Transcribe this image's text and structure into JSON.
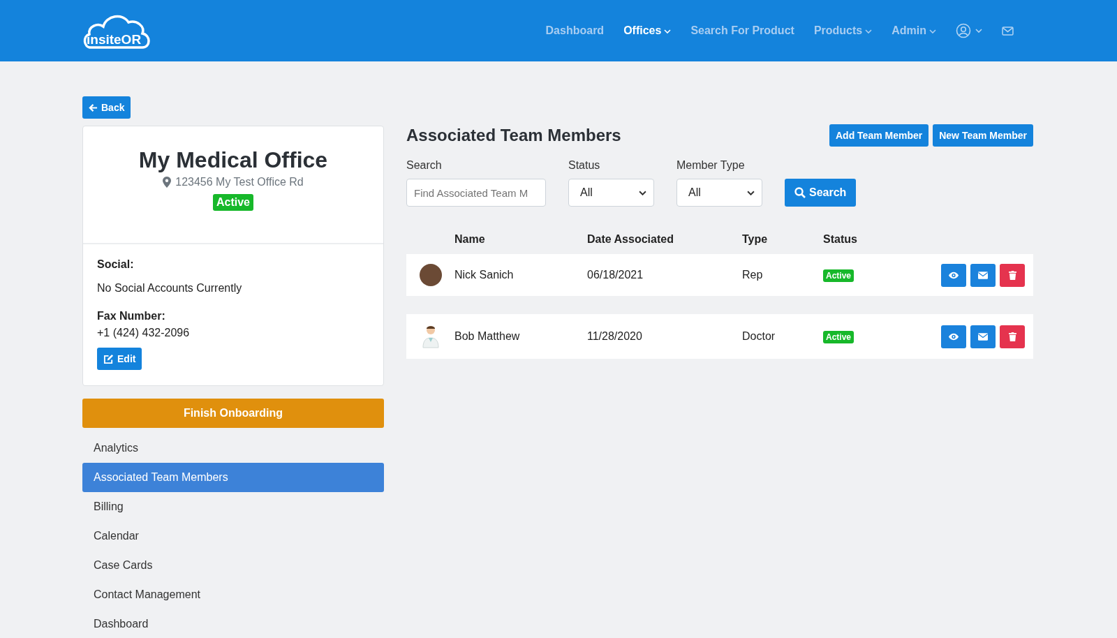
{
  "navbar": {
    "logo": "insiteOR",
    "items": [
      {
        "label": "Dashboard",
        "selected": false,
        "dropdown": false
      },
      {
        "label": "Offices",
        "selected": true,
        "dropdown": true
      },
      {
        "label": "Search For Product",
        "selected": false,
        "dropdown": false
      },
      {
        "label": "Products",
        "selected": false,
        "dropdown": true
      },
      {
        "label": "Admin",
        "selected": false,
        "dropdown": true
      }
    ]
  },
  "back_button": "Back",
  "office": {
    "name": "My Medical Office",
    "address": "123456 My Test Office Rd",
    "status": "Active",
    "social_label": "Social:",
    "social_value": "No Social Accounts Currently",
    "fax_label": "Fax Number:",
    "fax_value": "+1 (424) 432-2096",
    "edit_button": "Edit"
  },
  "finish_button": "Finish Onboarding",
  "sidebar": {
    "items": [
      {
        "label": "Analytics",
        "selected": false
      },
      {
        "label": "Associated Team Members",
        "selected": true
      },
      {
        "label": "Billing",
        "selected": false
      },
      {
        "label": "Calendar",
        "selected": false
      },
      {
        "label": "Case Cards",
        "selected": false
      },
      {
        "label": "Contact Management",
        "selected": false
      },
      {
        "label": "Dashboard",
        "selected": false
      }
    ]
  },
  "main": {
    "title": "Associated Team Members",
    "buttons": [
      "Add Team Member",
      "New Team Member"
    ],
    "filters": {
      "search_label": "Search",
      "search_placeholder": "Find Associated Team M",
      "status_label": "Status",
      "status_value": "All",
      "type_label": "Member Type",
      "type_value": "All",
      "search_button": "Search"
    },
    "table": {
      "columns": [
        "Name",
        "Date Associated",
        "Type",
        "Status"
      ],
      "rows": [
        {
          "name": "Nick Sanich",
          "date": "06/18/2021",
          "type": "Rep",
          "status": "Active",
          "kind": "photo"
        },
        {
          "name": "Bob Matthew",
          "date": "11/28/2020",
          "type": "Doctor",
          "status": "Active",
          "kind": "doctor"
        }
      ]
    }
  }
}
